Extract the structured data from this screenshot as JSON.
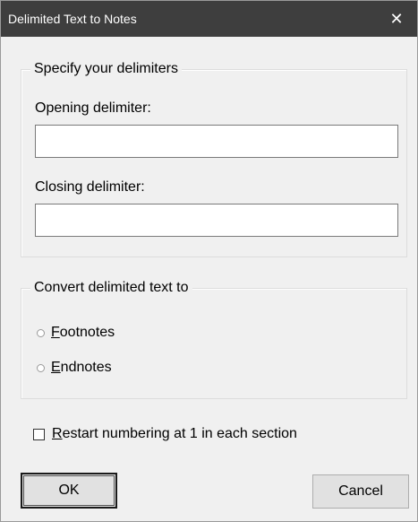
{
  "window": {
    "title": "Delimited Text to Notes",
    "close_glyph": "✕"
  },
  "delimiters": {
    "legend": "Specify your delimiters",
    "opening_label": "Opening delimiter:",
    "opening_value": "",
    "closing_label": "Closing delimiter:",
    "closing_value": ""
  },
  "convert": {
    "legend": "Convert delimited text to",
    "footnotes_accel": "F",
    "footnotes_rest": "ootnotes",
    "endnotes_accel": "E",
    "endnotes_rest": "ndnotes"
  },
  "restart": {
    "accel": "R",
    "rest": "estart numbering at 1 in each section"
  },
  "buttons": {
    "ok": "OK",
    "cancel": "Cancel"
  }
}
